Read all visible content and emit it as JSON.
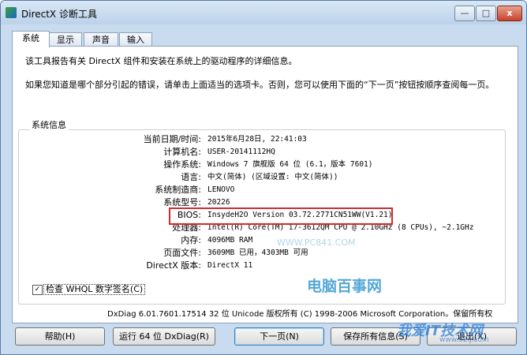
{
  "window": {
    "title": "DirectX 诊断工具"
  },
  "controls": {
    "minimize": "—",
    "maximize": "□",
    "close": "x"
  },
  "tabs": [
    "系统",
    "显示",
    "声音",
    "输入"
  ],
  "intro": {
    "line1": "该工具报告有关 DirectX 组件和安装在系统上的驱动程序的详细信息。",
    "line2": "如果您知道是哪个部分引起的错误，请单击上面适当的选项卡。否则，您可以使用下面的“下一页”按钮按顺序查阅每一页。"
  },
  "system_info": {
    "group_label": "系统信息",
    "rows": [
      {
        "label": "当前日期/时间:",
        "value": "2015年6月28日, 22:41:03"
      },
      {
        "label": "计算机名:",
        "value": "USER-20141112HQ"
      },
      {
        "label": "操作系统:",
        "value": "Windows 7 旗舰版 64 位 (6.1，版本 7601)"
      },
      {
        "label": "语言:",
        "value": "中文(简体) (区域设置: 中文(简体))"
      },
      {
        "label": "系统制造商:",
        "value": "LENOVO"
      },
      {
        "label": "系统型号:",
        "value": "20226"
      },
      {
        "label": "BIOS:",
        "value": "InsydeH2O Version 03.72.2771CN51WW(V1.21)"
      },
      {
        "label": "处理器:",
        "value": "Intel(R) Core(TM) i7-3612QM CPU @ 2.10GHz (8 CPUs), ~2.1GHz"
      },
      {
        "label": "内存:",
        "value": "4096MB RAM"
      },
      {
        "label": "页面文件:",
        "value": "3609MB 已用，4303MB 可用"
      },
      {
        "label": "DirectX 版本:",
        "value": "DirectX 11"
      }
    ]
  },
  "whql": {
    "label": "检查 WHQL 数字签名(C)",
    "checked": true,
    "mark": "✓"
  },
  "copyright": "DxDiag 6.01.7601.17514 32 位 Unicode 版权所有 (C) 1998-2006 Microsoft Corporation。保留所有权",
  "buttons": {
    "help": "帮助(H)",
    "run64": "运行 64 位 DxDiag(R)",
    "next": "下一页(N)",
    "save": "保存所有信息(S)",
    "exit": "退出(X)"
  },
  "watermarks": {
    "site1": "WWW.PC841.COM",
    "site1_name": "电脑百事网",
    "site2": "我爱IT技术网",
    "site2_url": "www.52ij.com"
  }
}
